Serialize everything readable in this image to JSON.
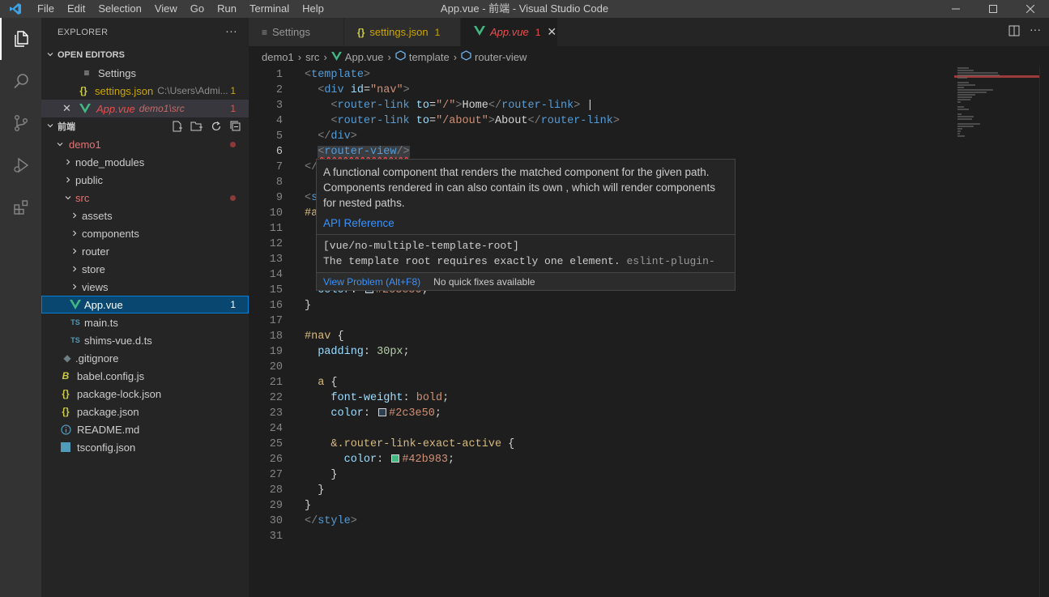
{
  "window": {
    "title": "App.vue - 前端 - Visual Studio Code",
    "menu": [
      "File",
      "Edit",
      "Selection",
      "View",
      "Go",
      "Run",
      "Terminal",
      "Help"
    ]
  },
  "sidebar": {
    "title": "EXPLORER",
    "open_editors_label": "OPEN EDITORS",
    "open_editors": [
      {
        "name": "Settings",
        "desc": "",
        "badge": ""
      },
      {
        "name": "settings.json",
        "desc": "C:\\Users\\Admi...",
        "badge": "1"
      },
      {
        "name": "App.vue",
        "desc": "demo1\\src",
        "badge": "1"
      }
    ],
    "workspace_label": "前端",
    "tree": {
      "demo1": "demo1",
      "node_modules": "node_modules",
      "public": "public",
      "src": "src",
      "assets": "assets",
      "components": "components",
      "router": "router",
      "store": "store",
      "views": "views",
      "app_vue": "App.vue",
      "app_vue_badge": "1",
      "main_ts": "main.ts",
      "shims": "shims-vue.d.ts",
      "gitignore": ".gitignore",
      "babel": "babel.config.js",
      "pkglock": "package-lock.json",
      "pkg": "package.json",
      "readme": "README.md",
      "tsconfig": "tsconfig.json",
      "ts_label": "TS"
    }
  },
  "tabs": [
    {
      "label": "Settings",
      "badge": ""
    },
    {
      "label": "settings.json",
      "badge": "1"
    },
    {
      "label": "App.vue",
      "badge": "1"
    }
  ],
  "breadcrumb": [
    "demo1",
    "src",
    "App.vue",
    "template",
    "router-view"
  ],
  "editor": {
    "line_numbers": [
      "1",
      "2",
      "3",
      "4",
      "5",
      "6",
      "7",
      "8",
      "9",
      "10",
      "11",
      "12",
      "13",
      "14",
      "15",
      "16",
      "17",
      "18",
      "19",
      "20",
      "21",
      "22",
      "23",
      "24",
      "25",
      "26",
      "27",
      "28",
      "29",
      "30",
      "31"
    ],
    "colors": {
      "swatch1": "#2c3e50",
      "swatch2": "#2c3e50",
      "swatch3": "#42b983"
    }
  },
  "hover": {
    "doc": "A functional component that renders the matched component for the given path. Components rendered in can also contain its own , which will render components for nested paths.",
    "link": "API Reference",
    "problem_code": "[vue/no-multiple-template-root]",
    "problem_msg": "The template root requires exactly one element.",
    "problem_src": "eslint-plugin-vue",
    "view_problem": "View Problem (Alt+F8)",
    "no_fixes": "No quick fixes available"
  }
}
